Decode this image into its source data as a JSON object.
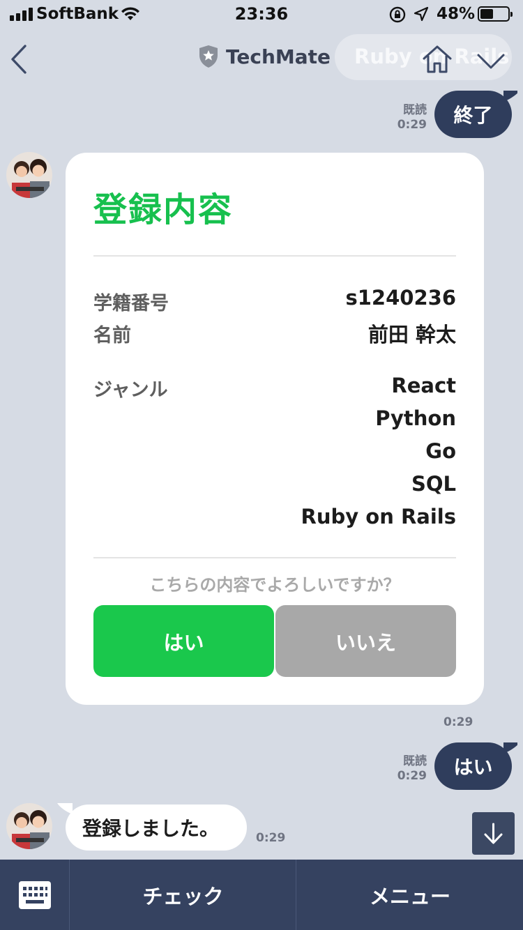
{
  "status_bar": {
    "carrier": "SoftBank",
    "time": "23:36",
    "battery_percent": "48%",
    "battery_level": 0.48,
    "icons": [
      "signal-icon",
      "wifi-icon",
      "rotation-lock-icon",
      "location-arrow-icon",
      "battery-icon"
    ]
  },
  "header": {
    "title": "TechMate",
    "ghost_label": "Ruby on Rails",
    "icons": [
      "back-chevron-icon",
      "shield-star-icon",
      "home-icon",
      "chevron-down-icon"
    ]
  },
  "messages": {
    "msg1": {
      "text": "終了",
      "read": "既読",
      "time": "0:29"
    },
    "card": {
      "title": "登録内容",
      "rows": [
        {
          "label": "学籍番号",
          "value": "s1240236"
        },
        {
          "label": "名前",
          "value": "前田 幹太"
        }
      ],
      "genre_label": "ジャンル",
      "genres": [
        "React",
        "Python",
        "Go",
        "SQL",
        "Ruby on Rails"
      ],
      "question": "こちらの内容でよろしいですか？",
      "yes_label": "はい",
      "no_label": "いいえ",
      "time": "0:29"
    },
    "msg2": {
      "text": "はい",
      "read": "既読",
      "time": "0:29"
    },
    "msg3": {
      "text": "登録しました。",
      "time": "0:29"
    }
  },
  "bottom_bar": {
    "check_label": "チェック",
    "menu_label": "メニュー",
    "icons": [
      "keyboard-icon",
      "arrow-down-icon"
    ]
  },
  "colors": {
    "background": "#d6dbe4",
    "accent_green": "#1ac84c",
    "title_green": "#17c04e",
    "bubble_navy": "#2f3d5c",
    "bar_navy": "#354260",
    "button_gray": "#a8a8a8"
  }
}
